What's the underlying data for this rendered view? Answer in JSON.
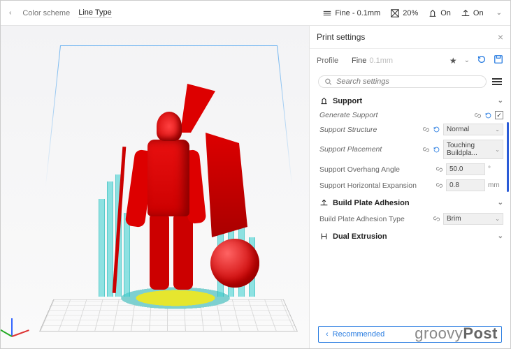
{
  "topbar": {
    "color_scheme_label": "Color scheme",
    "line_type": "Line Type",
    "quality": "Fine - 0.1mm",
    "infill": "20%",
    "support_toggle": "On",
    "adhesion_toggle": "On"
  },
  "panel": {
    "title": "Print settings",
    "profile_label": "Profile",
    "profile_value": "Fine",
    "profile_dim": "0.1mm",
    "search_placeholder": "Search settings",
    "recommended": "Recommended"
  },
  "sections": {
    "support": {
      "title": "Support",
      "generate": {
        "label": "Generate Support",
        "checked": true
      },
      "structure": {
        "label": "Support Structure",
        "value": "Normal"
      },
      "placement": {
        "label": "Support Placement",
        "value": "Touching Buildpla..."
      },
      "overhang": {
        "label": "Support Overhang Angle",
        "value": "50.0",
        "unit": "°"
      },
      "horiz": {
        "label": "Support Horizontal Expansion",
        "value": "0.8",
        "unit": "mm"
      }
    },
    "adhesion": {
      "title": "Build Plate Adhesion",
      "type": {
        "label": "Build Plate Adhesion Type",
        "value": "Brim"
      }
    },
    "dual": {
      "title": "Dual Extrusion"
    }
  },
  "watermark": {
    "a": "groovy",
    "b": "Post"
  }
}
